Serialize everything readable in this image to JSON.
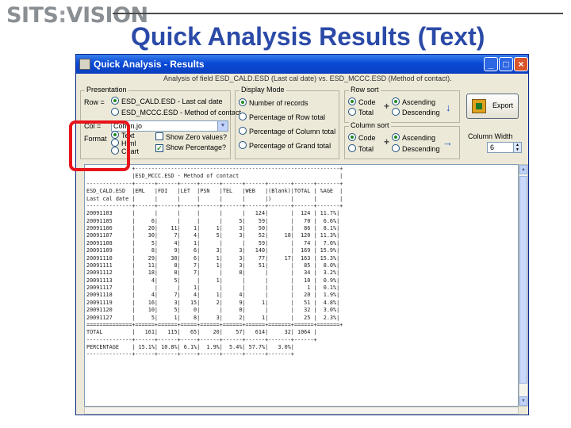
{
  "slide": {
    "logo_left": "SITS",
    "logo_sep": ":",
    "logo_right": "VISION",
    "title": "Quick Analysis Results (Text)"
  },
  "window": {
    "title": "Quick Analysis - Results",
    "analysis_description": "Analysis of field ESD_CALD.ESD (Last cal date) vs. ESD_MCCC.ESD (Method of contact)."
  },
  "presentation": {
    "label": "Presentation",
    "row_label": "Row =",
    "row_options": [
      "ESD_CALD.ESD - Last cal date",
      "ESD_MCCC.ESD - Method of contact"
    ],
    "col_label": "Col =",
    "col_value": "Cohen.jo",
    "format_label": "Format",
    "format_options": [
      "Text",
      "Html",
      "Chart"
    ],
    "show_zero_label": "Show Zero values?",
    "show_percentage_label": "Show Percentage?"
  },
  "display_mode": {
    "label": "Display Mode",
    "options": [
      "Number of records",
      "Percentage of Row total",
      "Percentage of Column total",
      "Percentage of Grand total"
    ]
  },
  "row_sort": {
    "label": "Row sort",
    "by_options": [
      "Code",
      "Total"
    ],
    "dir_options": [
      "Ascending",
      "Descending"
    ]
  },
  "column_sort": {
    "label": "Column sort",
    "by_options": [
      "Code",
      "Total"
    ],
    "dir_options": [
      "Ascending",
      "Descending"
    ]
  },
  "export": {
    "label": "Export"
  },
  "column_width": {
    "label": "Column Width",
    "value": "6"
  },
  "results_text": "              +---------------------------------------------------------------+\n              |ESD_MCCC.ESD - Method of contact                               |\n--------------+------+------+-----+------+------+------+-------+------+-------+\nESD_CALD.ESD  |EML   |FDI   |LET  |PSN   |TEL   |WEB   |(Blank)|TOTAL | %AGE  |\nLast cal date |      |      |     |      |      |      |)      |      |       |\n--------------+------+------+-----+------+------+------+-------+------+-------+\n20091103      |      |      |     |      |      |   124|       |  124 | 11.7%|\n20091105      |     6|      |     |      |     5|    59|       |   70 |  6.6%|\n20091106      |    20|    11|    1|     1|     3|    50|       |   86 |  8.1%|\n20091107      |    30|     7|    4|     5|     3|    52|     18|  120 | 11.3%|\n20091108      |     5|     4|    1|      |      |    59|       |   74 |  7.0%|\n20091109      |     8|     9|    6|     3|     3|   140|       |  169 | 15.9%|\n20091110      |    29|    30|    6|     1|     3|    77|     17|  163 | 15.3%|\n20091111      |    11|     8|    7|     1|     3|    51|       |   85 |  8.0%|\n20091112      |    18|     8|    7|      |     8|      |       |   34 |  3.2%|\n20091113      |     4|     5|     |     1|      |      |       |   10 |  0.9%|\n20091117      |      |      |    1|      |      |      |       |    1 |  0.1%|\n20091118      |     4|     7|    4|     1|     4|      |       |   20 |  1.9%|\n20091119      |    16|     3|   15|     2|     9|     1|       |   51 |  4.8%|\n20091120      |    10|     5|    0|      |     0|      |       |   32 |  3.0%|\n20091127      |     5|     1|    8|     3|     2|     1|       |   25 |  2.3%|\n==============+======+======+=====+======+======+======+=======+======+=======+\nTOTAL         |   161|   115|   65|    20|    57|   614|     32| 1064 |\n--------------+------+------+-----+------+------+------+-------+------+\nPERCENTAGE    | 15.1%| 10.8%| 6.1%|  1.9%|  5.4%| 57.7%|   3.0%|\n--------------+------+------+-----+------+------+------+-------+"
}
